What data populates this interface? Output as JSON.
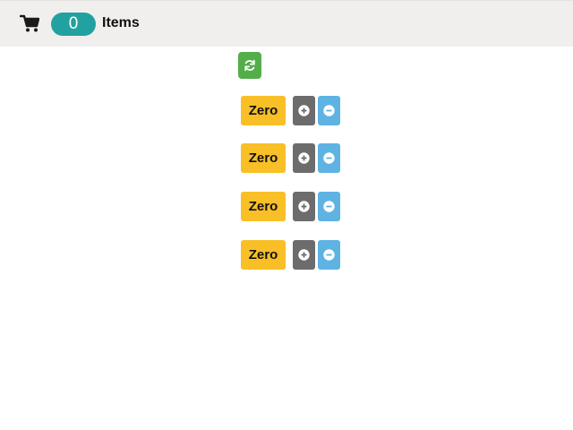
{
  "navbar": {
    "icon": "shopping-cart-icon",
    "item_count": "0",
    "items_label": "Items"
  },
  "refresh": {
    "icon": "refresh-icon"
  },
  "counters": [
    {
      "label": "Zero",
      "increment_icon": "plus-circle-icon",
      "decrement_icon": "minus-circle-icon"
    },
    {
      "label": "Zero",
      "increment_icon": "plus-circle-icon",
      "decrement_icon": "minus-circle-icon"
    },
    {
      "label": "Zero",
      "increment_icon": "plus-circle-icon",
      "decrement_icon": "minus-circle-icon"
    },
    {
      "label": "Zero",
      "increment_icon": "plus-circle-icon",
      "decrement_icon": "minus-circle-icon"
    }
  ],
  "colors": {
    "navbar_bg": "#f0efed",
    "count_badge": "#21a19f",
    "refresh_button": "#53ae4a",
    "value_badge": "#f8bf26",
    "increment_button": "#6c6c6c",
    "decrement_button": "#5eb3e3"
  }
}
